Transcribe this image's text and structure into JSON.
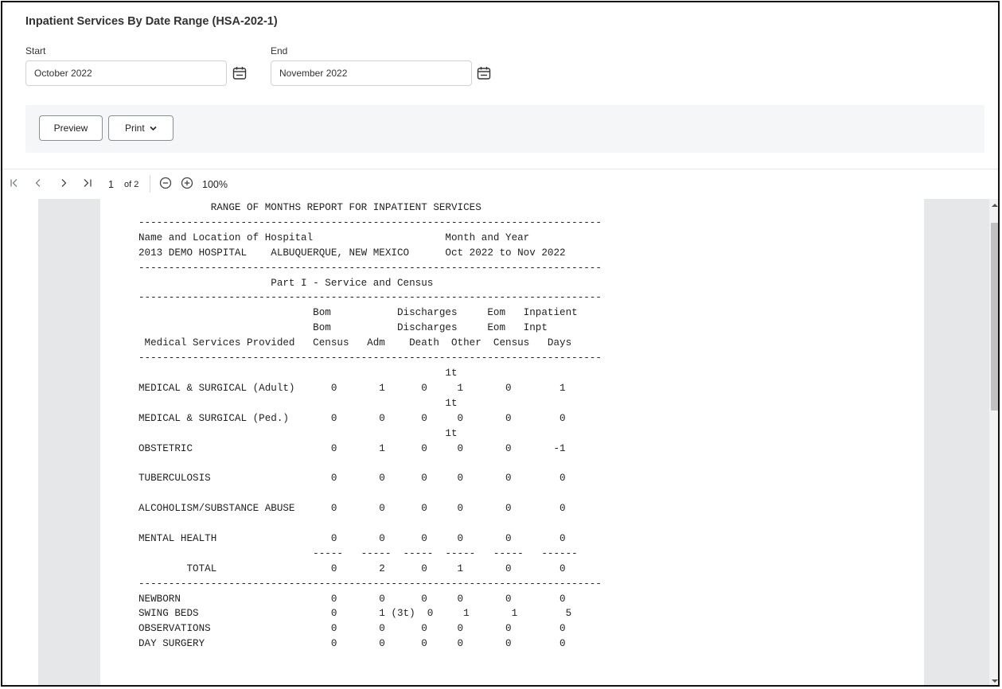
{
  "form": {
    "title": "Inpatient Services By Date Range (HSA-202-1)",
    "start_label": "Start",
    "start_value": "October 2022",
    "end_label": "End",
    "end_value": "November 2022"
  },
  "buttons": {
    "preview": "Preview",
    "print": "Print"
  },
  "icons": {
    "calendar": "calendar-icon",
    "first": "first-page-icon",
    "prev": "previous-page-icon",
    "next": "next-page-icon",
    "last": "last-page-icon",
    "zoom_out": "zoom-out-icon",
    "zoom_in": "zoom-in-icon",
    "chevron": "chevron-down-icon"
  },
  "toolbar": {
    "page_number": "1",
    "page_of": "of 2",
    "zoom": "100%"
  },
  "report": {
    "lines": [
      "            RANGE OF MONTHS REPORT FOR INPATIENT SERVICES",
      "-----------------------------------------------------------------------------",
      "Name and Location of Hospital                      Month and Year",
      "2013 DEMO HOSPITAL    ALBUQUERQUE, NEW MEXICO      Oct 2022 to Nov 2022",
      "-----------------------------------------------------------------------------",
      "                      Part I - Service and Census",
      "-----------------------------------------------------------------------------",
      "                             Bom           Discharges     Eom   Inpatient",
      "                             Bom           Discharges     Eom   Inpt",
      " Medical Services Provided   Census   Adm    Death  Other  Census   Days",
      "-----------------------------------------------------------------------------",
      "                                                   1t",
      "MEDICAL & SURGICAL (Adult)      0       1      0     1       0        1",
      "                                                   1t",
      "MEDICAL & SURGICAL (Ped.)       0       0      0     0       0        0",
      "                                                   1t",
      "OBSTETRIC                       0       1      0     0       0       -1",
      "",
      "TUBERCULOSIS                    0       0      0     0       0        0",
      "",
      "ALCOHOLISM/SUBSTANCE ABUSE      0       0      0     0       0        0",
      "",
      "MENTAL HEALTH                   0       0      0     0       0        0",
      "                             -----   -----  -----  -----   -----   ------",
      "        TOTAL                   0       2      0     1       0        0",
      "-----------------------------------------------------------------------------",
      "NEWBORN                         0       0      0     0       0        0",
      "SWING BEDS                      0       1 (3t)  0     1       1        5",
      "OBSERVATIONS                    0       0      0     0       0        0",
      "DAY SURGERY                     0       0      0     0       0        0"
    ]
  }
}
